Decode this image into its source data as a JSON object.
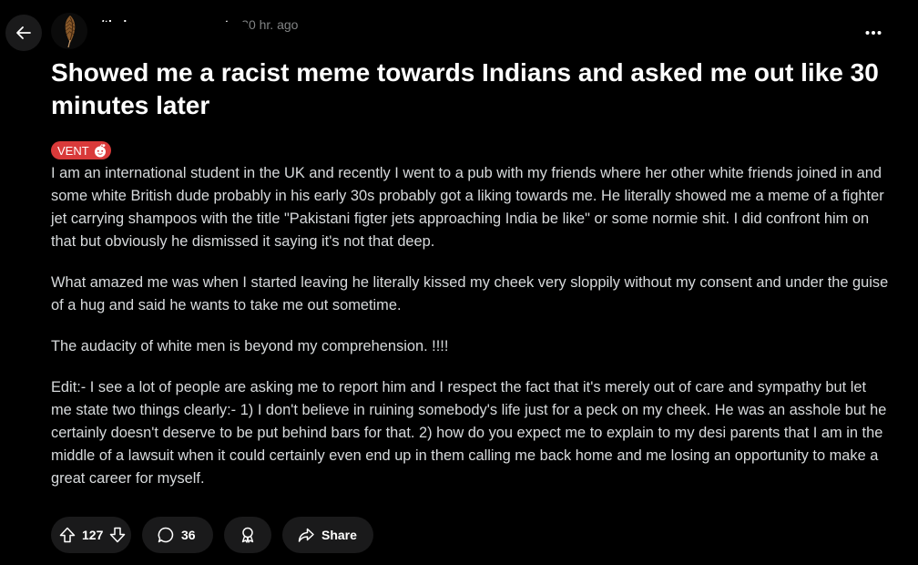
{
  "post": {
    "subreddit": "r/thebronzemovement",
    "separator": "•",
    "time_ago": "20 hr. ago",
    "title": "Showed me a racist meme towards Indians and asked me out like 30 minutes later",
    "flair": "VENT",
    "body": [
      "I am an international student in the UK and recently I went to a pub with my friends where her other white friends joined in and some white British dude probably in his early 30s probably got a liking towards me. He literally showed me a meme of a fighter jet carrying shampoos with the title \"Pakistani figter jets approaching India be like\" or some normie shit. I did confront him on that but obviously he dismissed it saying it's not that deep.",
      "What amazed me was when I started leaving he literally kissed my cheek very sloppily without my consent and under the guise of a hug and said he wants to take me out sometime.",
      "The audacity of white men is beyond my comprehension. !!!!",
      "Edit:- I see a lot of people are asking me to report him and I respect the fact that it's merely out of care and sympathy but let me state two things clearly:- 1) I don't believe in ruining somebody's life just for a peck on my cheek. He was an asshole but he certainly doesn't deserve to be put behind bars for that. 2) how do you expect me to explain to my desi parents that I am in the middle of a lawsuit when it could certainly even end up in them calling me back home and me losing an opportunity to make a great career for myself."
    ]
  },
  "actions": {
    "vote_count": "127",
    "comment_count": "36",
    "share_label": "Share"
  },
  "icons": {
    "back": "arrow-left-icon",
    "avatar": "feather-icon",
    "overflow": "ellipsis-icon",
    "flair": "snoo-icon",
    "upvote": "arrow-up-icon",
    "downvote": "arrow-down-icon",
    "comment": "speech-bubble-icon",
    "award": "award-icon",
    "share": "share-arrow-icon"
  },
  "colors": {
    "background": "#000000",
    "title": "#ffffff",
    "body_text": "#d7dadc",
    "muted": "#818384",
    "flair_bg": "#d93a3a",
    "pill_bg": "#1a1a1b"
  }
}
